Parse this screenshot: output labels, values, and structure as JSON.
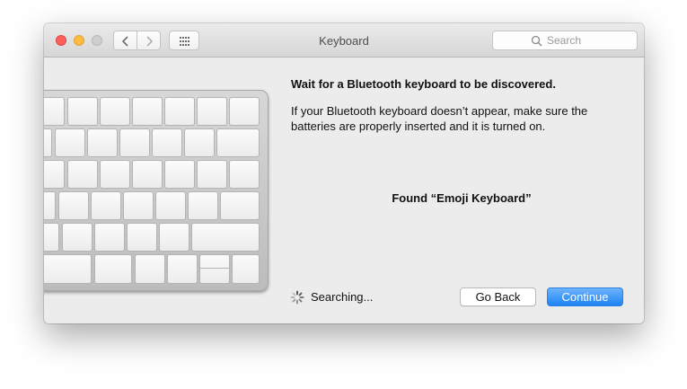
{
  "window": {
    "title": "Keyboard"
  },
  "toolbar": {
    "search_placeholder": "Search"
  },
  "content": {
    "heading": "Wait for a Bluetooth keyboard to be discovered.",
    "description": "If your Bluetooth keyboard doesn’t appear, make sure the batteries are properly inserted and it is turned on.",
    "found_text": "Found “Emoji Keyboard”",
    "status_text": "Searching..."
  },
  "buttons": {
    "back_label": "Go Back",
    "continue_label": "Continue"
  },
  "colors": {
    "accent": "#1d83f5",
    "close": "#fc605c",
    "minimize": "#fdbc40"
  },
  "icons": [
    "close-button",
    "minimize-button",
    "zoom-button",
    "chevron-left-icon",
    "chevron-right-icon",
    "grid-icon",
    "search-icon",
    "spinner-icon"
  ]
}
